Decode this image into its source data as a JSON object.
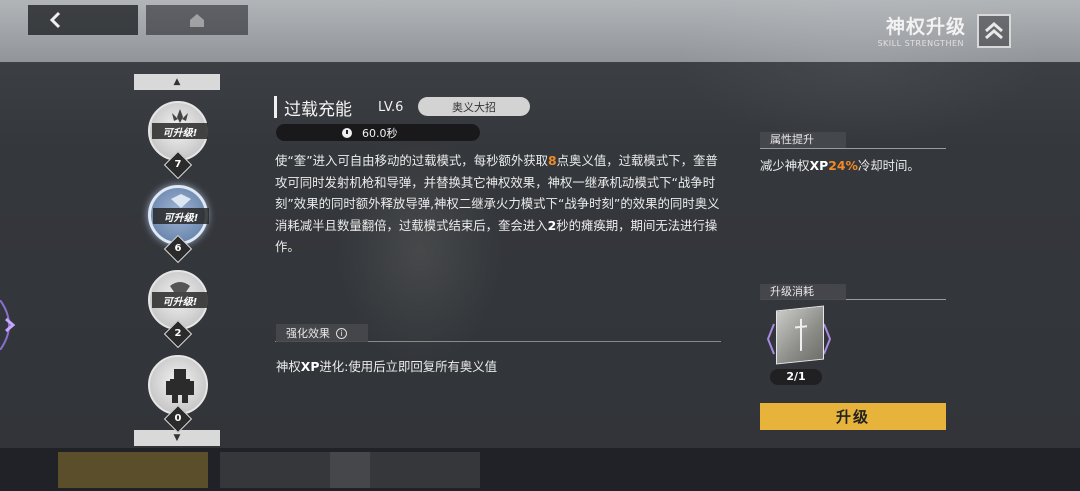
{
  "header": {
    "title": "神权升级",
    "subtitle": "SKILL STRENGTHEN"
  },
  "nav": {
    "nodes": [
      {
        "tag": "可升级!",
        "level": "7"
      },
      {
        "tag": "可升级!",
        "level": "6"
      },
      {
        "tag": "可升级!",
        "level": "2"
      },
      {
        "tag": "",
        "level": "0"
      }
    ]
  },
  "skill": {
    "name": "过载充能",
    "level": "LV.6",
    "type": "奥义大招",
    "cooldown": "60.0秒",
    "description": {
      "p1": "使“奎”进入可自由移动的过载模式，每秒额外获取",
      "n1": "8",
      "p2": "点奥义值，过载模式下，奎普攻可同时发射机枪和导弹，并替换其它神权效果，神权一继承机动模式下“战争时刻”效果的同时额外释放导弹,神权二继承火力模式下“战争时刻”的效果的同时奥义消耗减半且数量翻倍，过载模式结束后，奎会进入",
      "n2": "2",
      "p3": "秒的瘫痪期，期间无法进行操作。"
    }
  },
  "enhancement": {
    "label": "强化效果",
    "prefix": "神权",
    "bold": "XP",
    "suffix": "进化:使用后立即回复所有奥义值"
  },
  "attribute": {
    "label": "属性提升",
    "prefix": "减少神权",
    "bold": "XP",
    "percent": "24%",
    "suffix": "冷却时间。"
  },
  "cost": {
    "label": "升级消耗",
    "count": "2/1",
    "button": "升级"
  },
  "colors": {
    "highlight": "#f08a28",
    "upgrade_button": "#e8b33a"
  }
}
